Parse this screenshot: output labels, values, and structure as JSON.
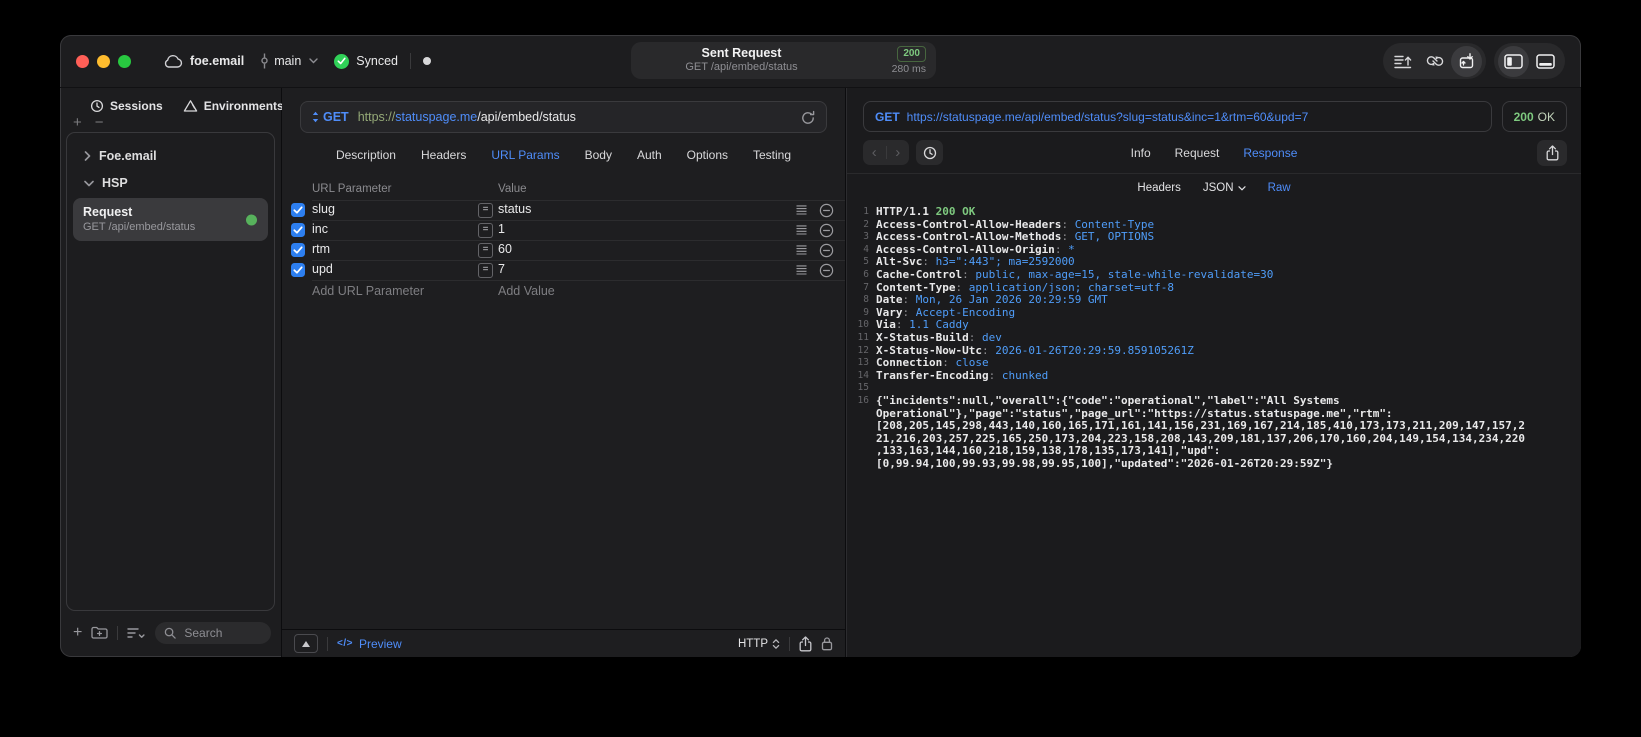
{
  "titlebar": {
    "project": "foe.email",
    "branch": "main",
    "sync_status": "Synced",
    "request_summary": {
      "title": "Sent Request",
      "subtitle": "GET /api/embed/status",
      "status_code": "200",
      "duration": "280 ms"
    }
  },
  "sidebar": {
    "tabs": [
      {
        "label": "Sessions",
        "icon": "history-icon"
      },
      {
        "label": "Environments",
        "icon": "environments-icon"
      }
    ],
    "tree": [
      {
        "label": "Foe.email",
        "expanded": false
      },
      {
        "label": "HSP",
        "expanded": true
      }
    ],
    "request_item": {
      "name": "Request",
      "detail": "GET /api/embed/status"
    },
    "search_placeholder": "Search"
  },
  "request_editor": {
    "method": "GET",
    "url": {
      "scheme": "https://",
      "host": "statuspage.me",
      "path": "/api/embed/status"
    },
    "tabs": [
      "Description",
      "Headers",
      "URL Params",
      "Body",
      "Auth",
      "Options",
      "Testing"
    ],
    "active_tab": "URL Params",
    "params": {
      "columns": [
        "URL Parameter",
        "Value"
      ],
      "rows": [
        {
          "enabled": true,
          "name": "slug",
          "value": "status"
        },
        {
          "enabled": true,
          "name": "inc",
          "value": "1"
        },
        {
          "enabled": true,
          "name": "rtm",
          "value": "60"
        },
        {
          "enabled": true,
          "name": "upd",
          "value": "7"
        }
      ],
      "add_parameter_placeholder": "Add URL Parameter",
      "add_value_placeholder": "Add Value"
    },
    "footer": {
      "code_glyph": "</>",
      "preview_label": "Preview",
      "protocol": "HTTP"
    }
  },
  "response_viewer": {
    "method": "GET",
    "url": "https://statuspage.me/api/embed/status?slug=status&inc=1&rtm=60&upd=7",
    "status_code": "200",
    "status_text": "OK",
    "tabs": [
      "Info",
      "Request",
      "Response"
    ],
    "active_tab": "Response",
    "subtabs": [
      {
        "label": "Headers"
      },
      {
        "label": "JSON",
        "dropdown": true
      },
      {
        "label": "Raw"
      }
    ],
    "active_subtab": "Raw",
    "lines": [
      {
        "num": "1",
        "seg": [
          [
            "HTTP/1.1 ",
            "w"
          ],
          [
            "200 OK",
            "g"
          ]
        ]
      },
      {
        "num": "2",
        "seg": [
          [
            "Access-Control-Allow-Headers",
            "w"
          ],
          [
            ": ",
            "d"
          ],
          [
            "Content-Type",
            "b"
          ]
        ]
      },
      {
        "num": "3",
        "seg": [
          [
            "Access-Control-Allow-Methods",
            "w"
          ],
          [
            ": ",
            "d"
          ],
          [
            "GET, OPTIONS",
            "b"
          ]
        ]
      },
      {
        "num": "4",
        "seg": [
          [
            "Access-Control-Allow-Origin",
            "w"
          ],
          [
            ": ",
            "d"
          ],
          [
            "*",
            "b"
          ]
        ]
      },
      {
        "num": "5",
        "seg": [
          [
            "Alt-Svc",
            "w"
          ],
          [
            ": ",
            "d"
          ],
          [
            "h3=\":443\"; ma=2592000",
            "b"
          ]
        ]
      },
      {
        "num": "6",
        "seg": [
          [
            "Cache-Control",
            "w"
          ],
          [
            ": ",
            "d"
          ],
          [
            "public, max-age=15, stale-while-revalidate=30",
            "b"
          ]
        ]
      },
      {
        "num": "7",
        "seg": [
          [
            "Content-Type",
            "w"
          ],
          [
            ": ",
            "d"
          ],
          [
            "application/json; charset=utf-8",
            "b"
          ]
        ]
      },
      {
        "num": "8",
        "seg": [
          [
            "Date",
            "w"
          ],
          [
            ": ",
            "d"
          ],
          [
            "Mon, 26 Jan 2026 20:29:59 GMT",
            "b"
          ]
        ]
      },
      {
        "num": "9",
        "seg": [
          [
            "Vary",
            "w"
          ],
          [
            ": ",
            "d"
          ],
          [
            "Accept-Encoding",
            "b"
          ]
        ]
      },
      {
        "num": "10",
        "seg": [
          [
            "Via",
            "w"
          ],
          [
            ": ",
            "d"
          ],
          [
            "1.1 Caddy",
            "b"
          ]
        ]
      },
      {
        "num": "11",
        "seg": [
          [
            "X-Status-Build",
            "w"
          ],
          [
            ": ",
            "d"
          ],
          [
            "dev",
            "b"
          ]
        ]
      },
      {
        "num": "12",
        "seg": [
          [
            "X-Status-Now-Utc",
            "w"
          ],
          [
            ": ",
            "d"
          ],
          [
            "2026-01-26T20:29:59.859105261Z",
            "b"
          ]
        ]
      },
      {
        "num": "13",
        "seg": [
          [
            "Connection",
            "w"
          ],
          [
            ": ",
            "d"
          ],
          [
            "close",
            "b"
          ]
        ]
      },
      {
        "num": "14",
        "seg": [
          [
            "Transfer-Encoding",
            "w"
          ],
          [
            ": ",
            "d"
          ],
          [
            "chunked",
            "b"
          ]
        ]
      },
      {
        "num": "15",
        "seg": []
      },
      {
        "num": "16",
        "body": true
      }
    ],
    "body": "{\"incidents\":null,\"overall\":{\"code\":\"operational\",\"label\":\"All Systems Operational\"},\"page\":\"status\",\"page_url\":\"https://status.statuspage.me\",\"rtm\":[208,205,145,298,443,140,160,165,171,161,141,156,231,169,167,214,185,410,173,173,211,209,147,157,221,216,203,257,225,165,250,173,204,223,158,208,143,209,181,137,206,170,160,204,149,154,134,234,220,133,163,144,160,218,159,138,178,135,173,141],\"upd\":[0,99.94,100,99.93,99.98,99.95,100],\"updated\":\"2026-01-26T20:29:59Z\"}"
  },
  "colors": {
    "accent_blue": "#4f8df9",
    "value_blue": "#4f9df9",
    "status_green": "#7ec97f",
    "synced_green": "#30d158",
    "checkbox_blue": "#2d7ff0",
    "scheme_olive": "#94a877",
    "traffic_red": "#ff5f57",
    "traffic_yellow": "#febc2e",
    "traffic_green": "#28c840"
  }
}
